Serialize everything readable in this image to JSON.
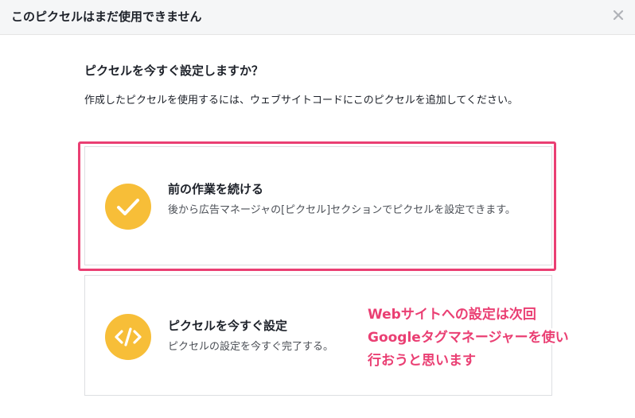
{
  "dialog": {
    "title": "このピクセルはまだ使用できません",
    "close_icon": "close-icon"
  },
  "main": {
    "question": "ピクセルを今すぐ設定しますか？",
    "description": "作成したピクセルを使用するには、ウェブサイトコードにこのピクセルを追加してください。"
  },
  "options": [
    {
      "icon": "checkmark-icon",
      "title": "前の作業を続ける",
      "description": "後から広告マネージャの[ピクセル]セクションでピクセルを設定できます。",
      "highlighted": true
    },
    {
      "icon": "code-icon",
      "title": "ピクセルを今すぐ設定",
      "description": "ピクセルの設定を今すぐ完了する。",
      "highlighted": false
    }
  ],
  "annotation": {
    "lines": [
      "Webサイトへの設定は次回",
      "Googleタグマネージャーを使い",
      "行おうと思います"
    ]
  },
  "colors": {
    "accent_highlight": "#ea3f73",
    "icon_background": "#f7be38",
    "header_background": "#f5f6f7"
  }
}
